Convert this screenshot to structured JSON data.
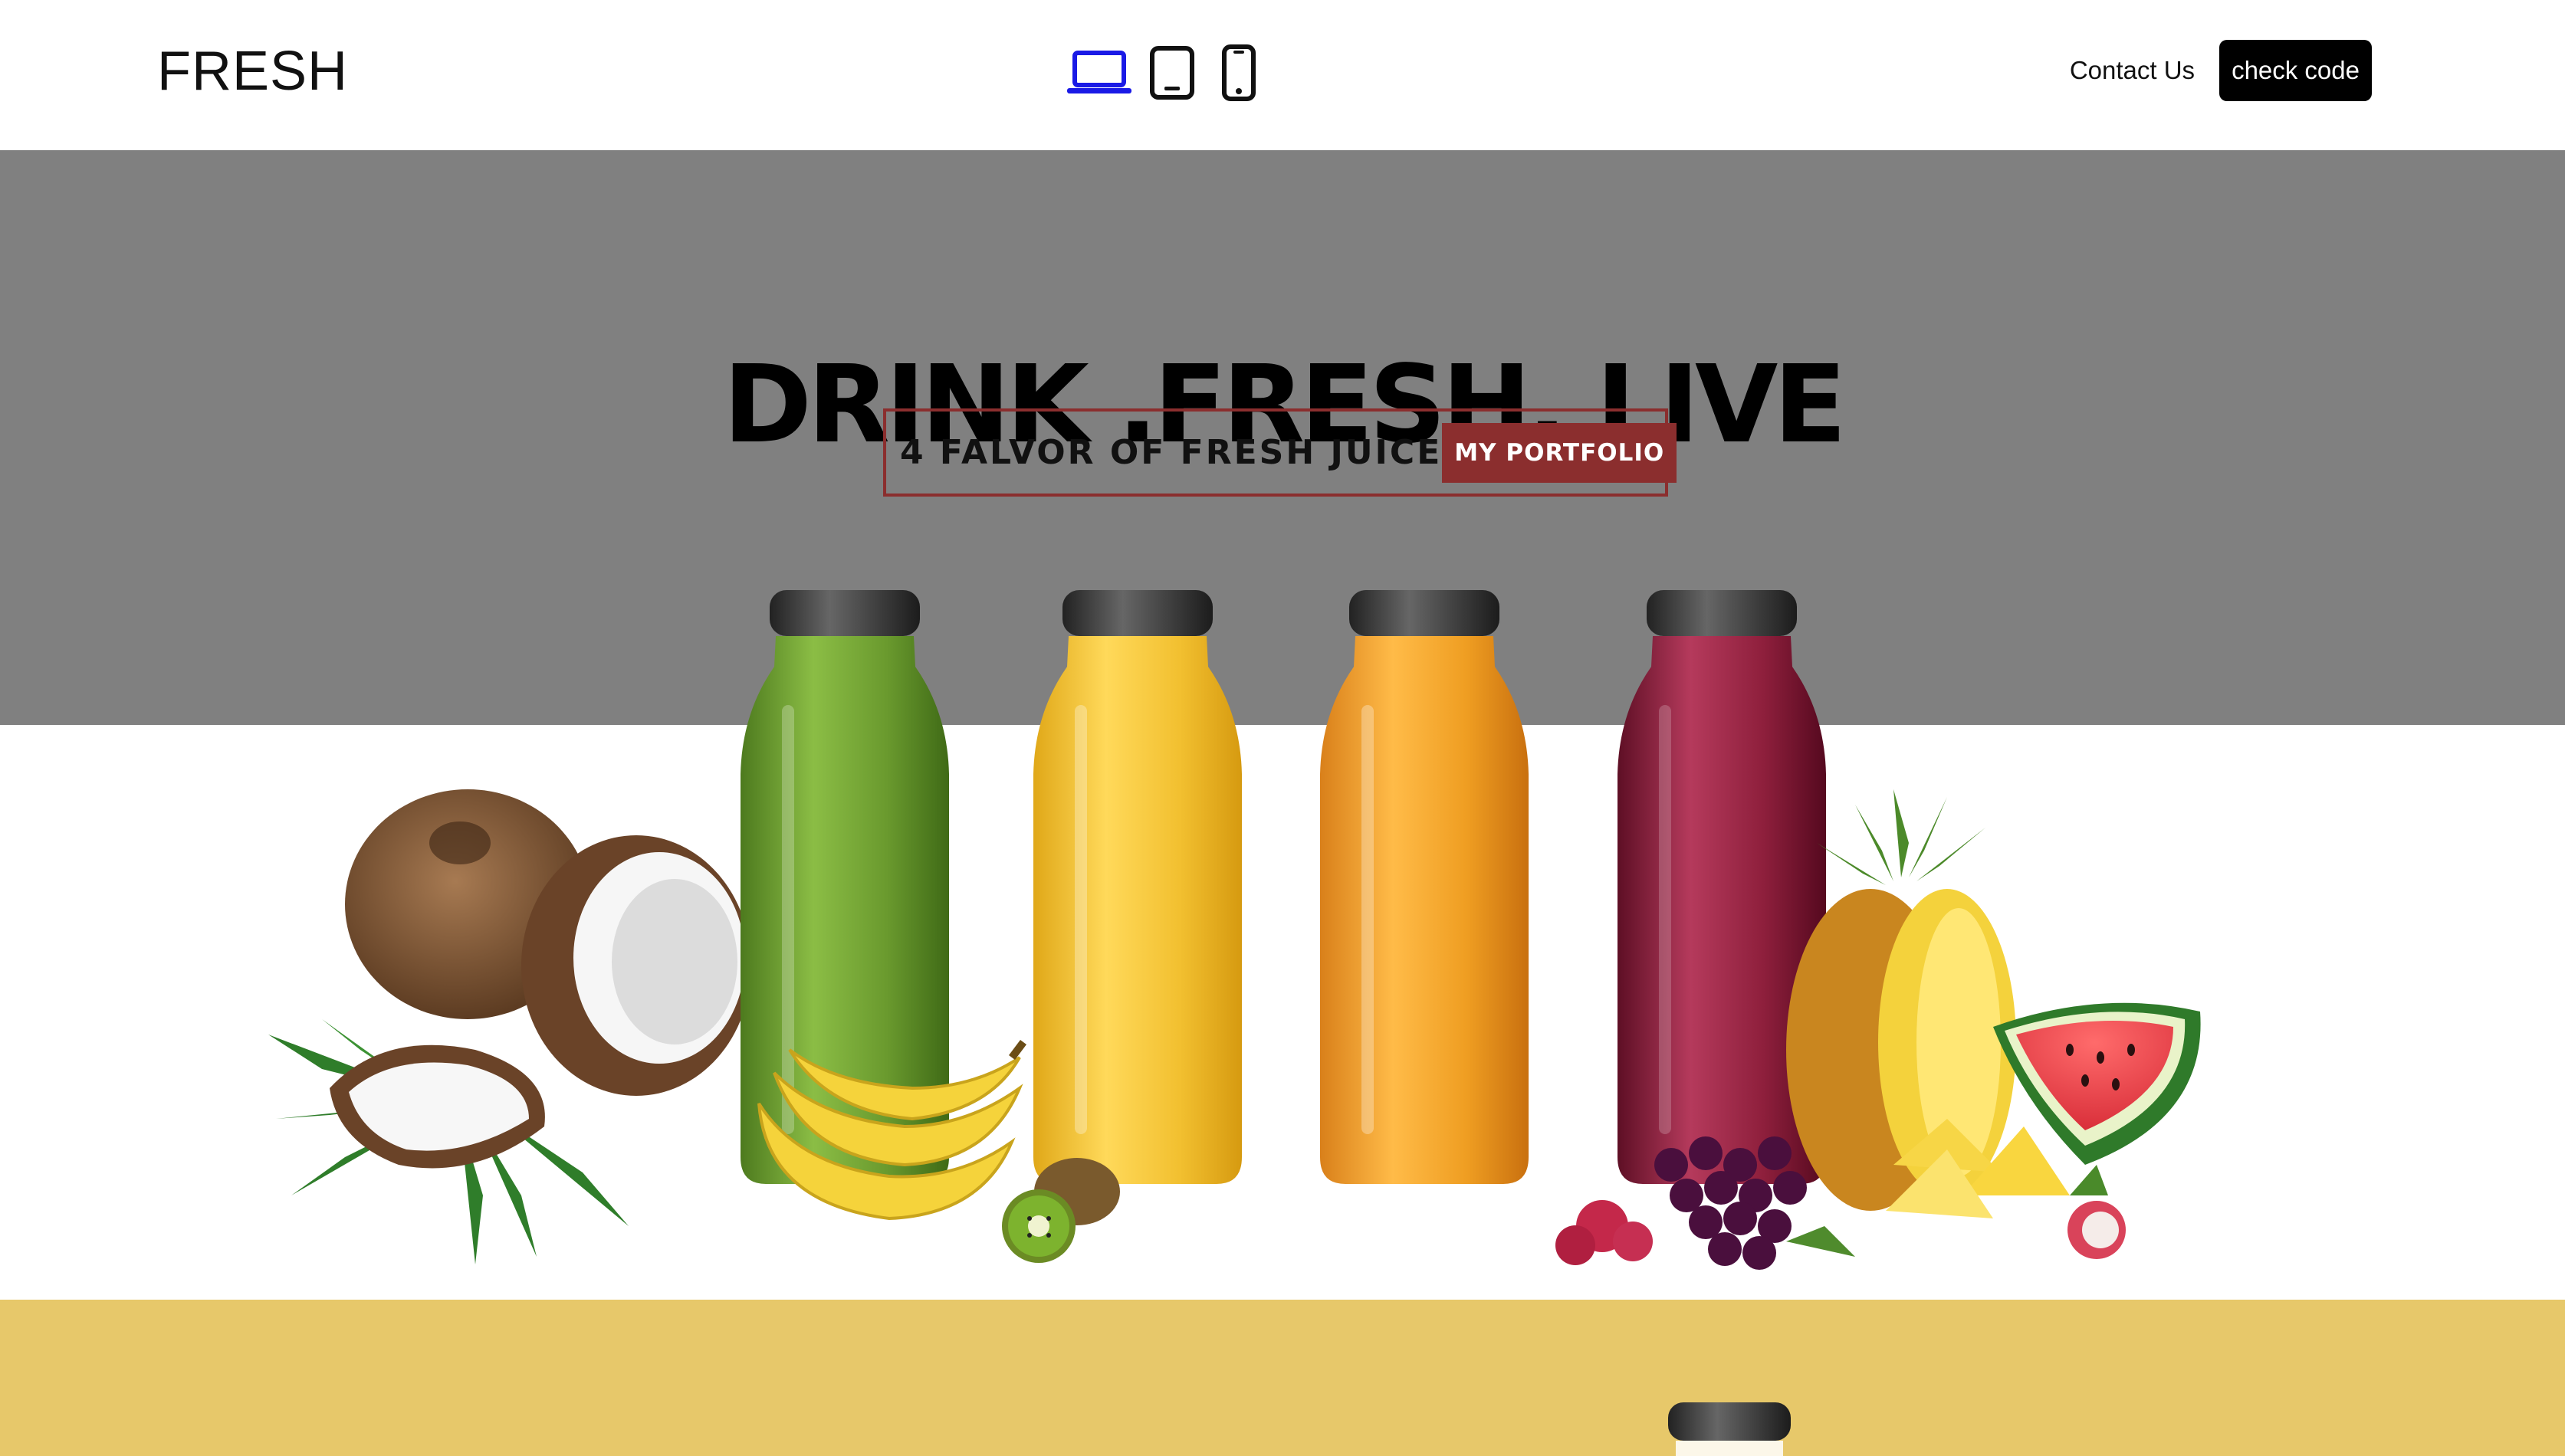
{
  "header": {
    "logo": "FRESH",
    "devices": [
      {
        "name": "laptop",
        "active": true
      },
      {
        "name": "tablet",
        "active": false
      },
      {
        "name": "phone",
        "active": false
      }
    ],
    "contact_label": "Contact Us",
    "check_code_label": "check code"
  },
  "hero": {
    "title": "DRINK .FRESH. LIVE",
    "subtitle": "4 FALVOR OF FRESH JUICE",
    "portfolio_label": "MY PORTFOLIO"
  },
  "products": [
    {
      "name": "green-juice",
      "color": "#6a9a2e"
    },
    {
      "name": "yellow-juice",
      "color": "#f2c030"
    },
    {
      "name": "orange-juice",
      "color": "#ef9e22"
    },
    {
      "name": "berry-juice",
      "color": "#8e1f3c"
    }
  ],
  "colors": {
    "hero_bg": "#808080",
    "accent": "#8b2e2e",
    "active_device": "#1a1ae6",
    "yellow_section": "#e7c86a"
  },
  "icons": [
    "laptop-icon",
    "tablet-icon",
    "phone-icon"
  ]
}
